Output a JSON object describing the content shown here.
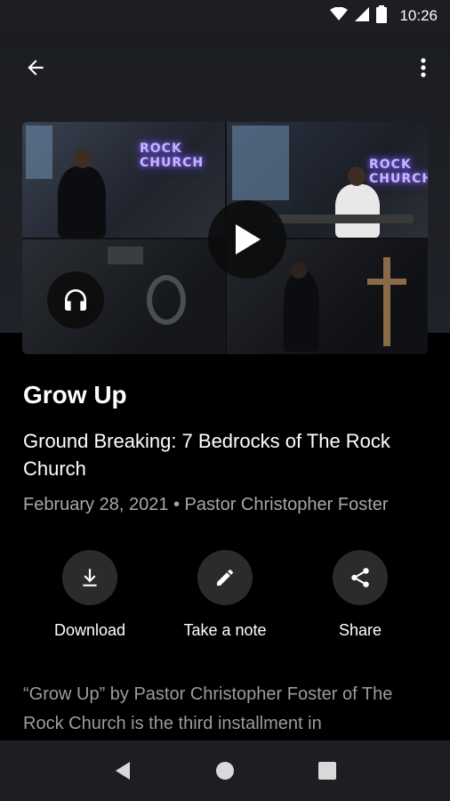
{
  "status_bar": {
    "time": "10:26"
  },
  "episode": {
    "title": "Grow Up",
    "series": "Ground Breaking: 7 Bedrocks of The Rock Church",
    "meta": "February 28, 2021 • Pastor Christopher Foster",
    "description": "“Grow Up” by Pastor Christopher Foster of The Rock Church is the third installment in"
  },
  "media": {
    "neon_text_1": "ROCK\nCHURCH",
    "neon_text_2": "ROCK\nCHURCH"
  },
  "actions": {
    "download_label": "Download",
    "note_label": "Take a note",
    "share_label": "Share"
  },
  "icons": {
    "back": "arrow-left-icon",
    "more": "more-vert-icon",
    "play": "play-icon",
    "audio": "headphones-icon",
    "download": "download-icon",
    "note": "pencil-icon",
    "share": "share-icon",
    "nav_back": "triangle-back-icon",
    "nav_home": "circle-home-icon",
    "nav_recents": "square-recents-icon"
  },
  "colors": {
    "background": "#000000",
    "surface": "#1c1e22",
    "action_circle": "#2b2b2b",
    "meta_text": "#a7a7a7"
  }
}
